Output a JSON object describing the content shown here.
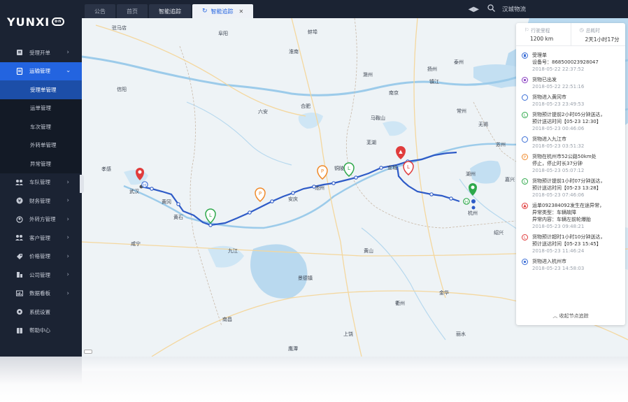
{
  "brand": {
    "logo_text": "YUNXI",
    "logo_badge": "on"
  },
  "sidebar": {
    "items": [
      {
        "label": "受理开单",
        "icon": "form-icon"
      },
      {
        "label": "运输管理",
        "icon": "document-icon",
        "active": true
      },
      {
        "label": "车队管理",
        "icon": "fleet-icon"
      },
      {
        "label": "财务管理",
        "icon": "finance-icon"
      },
      {
        "label": "外转方管理",
        "icon": "partner-icon"
      },
      {
        "label": "客户管理",
        "icon": "customer-icon"
      },
      {
        "label": "价格管理",
        "icon": "price-tag-icon"
      },
      {
        "label": "公司管理",
        "icon": "company-icon"
      },
      {
        "label": "数据看板",
        "icon": "dashboard-icon"
      },
      {
        "label": "系统设置",
        "icon": "gear-icon"
      },
      {
        "label": "帮助中心",
        "icon": "book-icon"
      }
    ],
    "sub_items": [
      "受理单管理",
      "运单管理",
      "车次管理",
      "外转单管理",
      "异常管理"
    ]
  },
  "tabs": [
    {
      "label": "公告"
    },
    {
      "label": "首页"
    },
    {
      "label": "智能追踪"
    },
    {
      "label": "智能追踪",
      "active": true,
      "closable": true
    }
  ],
  "topbar": {
    "company": "汉城物流"
  },
  "stats": {
    "distance_label": "行驶里程",
    "distance_value": "1200 km",
    "duration_label": "总耗时",
    "duration_value": "2天1小时17分"
  },
  "events": [
    {
      "type": "created",
      "color": "#3c6fd6",
      "title": "受理单",
      "detail": "设备号：868500023928047",
      "time": "2018-05-22 22:37:52"
    },
    {
      "type": "departed",
      "color": "#8a3fc2",
      "title": "货物已出发",
      "time": "2018-05-22 22:51:16"
    },
    {
      "type": "entered",
      "color": "#3c6fd6",
      "title": "货物进入黄冈市",
      "time": "2018-05-23 23:49:53"
    },
    {
      "type": "early",
      "color": "#2ea84a",
      "title": "货物预计提前2小时05分钟送达，",
      "detail": "预计送达时间【05-23 12:30】",
      "time": "2018-05-23 00:46:06"
    },
    {
      "type": "entered",
      "color": "#3c6fd6",
      "title": "货物进入九江市",
      "time": "2018-05-23 03:51:32"
    },
    {
      "type": "parked",
      "color": "#f08a2a",
      "title": "货物在杭州市52公路50km处",
      "detail": "停止，停止时长37分钟",
      "time": "2018-05-23 05:07:12"
    },
    {
      "type": "early",
      "color": "#2ea84a",
      "title": "货物预计提前1小时07分钟送达，",
      "detail": "预计送达时间【05-23 13:28】",
      "time": "2018-05-23 07:46:06"
    },
    {
      "type": "exception",
      "color": "#e03c3c",
      "title": "运单092384092发生在途异常，",
      "detail": "异常类型：车辆故障",
      "detail2": "异常内容：车辆左前轮爆胎",
      "time": "2018-05-23 09:48:21"
    },
    {
      "type": "late",
      "color": "#e03c3c",
      "title": "货物预计超时1小时10分钟送达，",
      "detail": "预计送达时间【05-23 15:45】",
      "time": "2018-05-23 11:46:24"
    },
    {
      "type": "arrived",
      "color": "#3c6fd6",
      "title": "货物进入杭州市",
      "time": "2018-05-23 14:58:03"
    }
  ],
  "collapse_label": "收起节点追踪",
  "map": {
    "cities": [
      "驻马店",
      "阜阳",
      "蚌埠",
      "淮南",
      "泰州",
      "扬州",
      "滁州",
      "镇江",
      "信阳",
      "南京",
      "合肥",
      "六安",
      "常州",
      "无锡",
      "马鞍山",
      "苏州",
      "芜湖",
      "孝感",
      "铜陵",
      "宣城",
      "湖州",
      "嘉兴",
      "武汉",
      "黄冈",
      "池州",
      "安庆",
      "杭州",
      "黄石",
      "绍兴",
      "咸宁",
      "九江",
      "黄山",
      "景德镇",
      "金华",
      "衢州",
      "南昌",
      "上饶",
      "丽水",
      "鹰潭"
    ]
  }
}
